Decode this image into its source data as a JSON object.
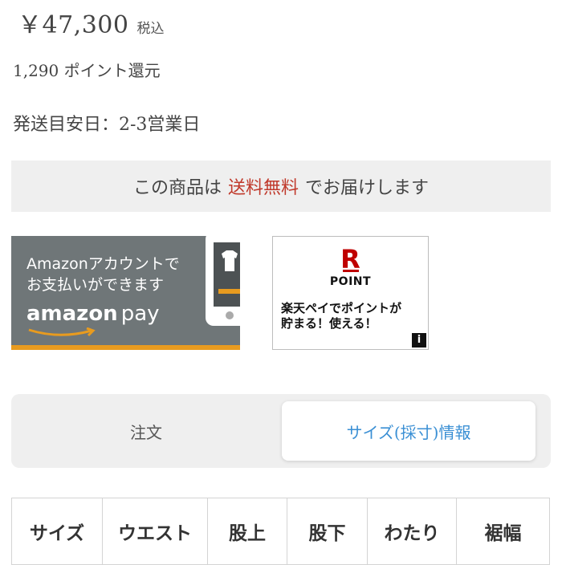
{
  "price": {
    "amount": "￥47,300",
    "tax_label": "税込"
  },
  "points_text": "1,290 ポイント還元",
  "shipping_text": "発送目安日：2-3営業日",
  "free_shipping": {
    "before": "この商品は",
    "highlight": "送料無料",
    "after": "でお届けします",
    "highlight_color": "#c0392b"
  },
  "amazon_pay_banner": {
    "line1": "Amazonアカウントで",
    "line2": "お支払いができます",
    "logo_main": "amazon",
    "logo_pay": "pay",
    "accent_color": "#e89b1f"
  },
  "rakuten_banner": {
    "logo_letter": "R",
    "logo_text": "POINT",
    "catch_line1": "楽天ペイでポイントが",
    "catch_line2": "貯まる！使える！",
    "info_icon": "i",
    "brand_color": "#bf0000"
  },
  "tabs": {
    "order_label": "注文",
    "size_label": "サイズ(採寸)情報",
    "active": "size",
    "active_color": "#3a8fd4"
  },
  "size_table": {
    "headers": [
      "サイズ",
      "ウエスト",
      "股上",
      "股下",
      "わたり",
      "裾幅"
    ]
  }
}
